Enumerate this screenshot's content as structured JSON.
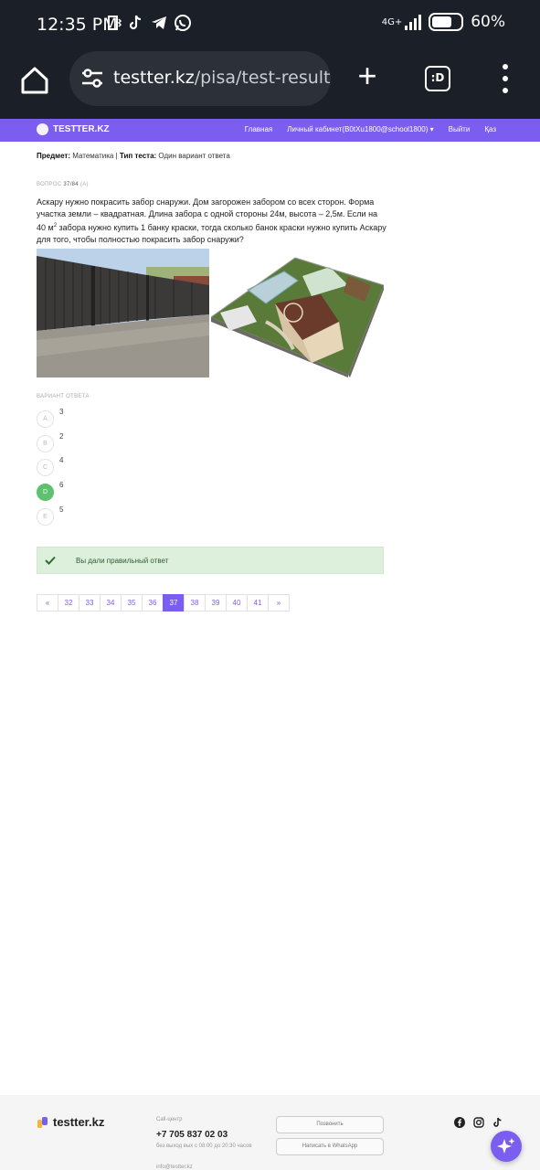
{
  "status_bar": {
    "time": "12:35 PM",
    "network": "4G+",
    "battery": "60%"
  },
  "browser": {
    "url_host": "testter.kz",
    "url_path": "/pisa/test-result/s",
    "tab_count": ":D"
  },
  "site_nav": {
    "logo": "TESTTER.KZ",
    "links": [
      "Главная",
      "Личный кабинет(B0tXu1800@school1800) ▾",
      "Выйти",
      "Қаз"
    ]
  },
  "test_info": {
    "subject_label": "Предмет:",
    "subject": "Математика",
    "separator": "|",
    "type_label": "Тип теста:",
    "type": "Один вариант ответа"
  },
  "question": {
    "label": "ВОПРОС",
    "number": "37/84",
    "tag": "(A)",
    "text_part1": "Аскару нужно покрасить забор снаружи. Дом загорожен забором со всех сторон. Форма участка земли – квадратная. Длина забора с одной стороны 24м, высота – 2,5м. Если на 40 м",
    "superscript": "2",
    "text_part2": " забора нужно купить 1 банку краски, тогда сколько банок краски нужно купить Аскару для того, чтобы полностью покрасить забор снаружи?"
  },
  "answers": {
    "label": "ВАРИАНТ ОТВЕТА",
    "options": [
      {
        "letter": "A",
        "value": "3"
      },
      {
        "letter": "B",
        "value": "2"
      },
      {
        "letter": "C",
        "value": "4"
      },
      {
        "letter": "D",
        "value": "6"
      },
      {
        "letter": "E",
        "value": "5"
      }
    ],
    "correct": "D"
  },
  "result_message": "Вы дали правильный ответ",
  "pagination": [
    "«",
    "32",
    "33",
    "34",
    "35",
    "36",
    "37",
    "38",
    "39",
    "40",
    "41",
    "»"
  ],
  "pagination_active": "37",
  "footer": {
    "logo": "testter.kz",
    "call_center_label": "Call-центр",
    "phone": "+7 705 837 02 03",
    "hours": "без выход вых с 08:00 до 20:30 часов",
    "email": "info@testter.kz",
    "call_button": "Позвонить",
    "whatsapp_button": "Написать в WhatsApp"
  },
  "colors": {
    "brand": "#7b5ef0",
    "success": "#5ec16d",
    "alert_bg": "#dcf0dc",
    "chrome_bg": "#1b1f27"
  }
}
